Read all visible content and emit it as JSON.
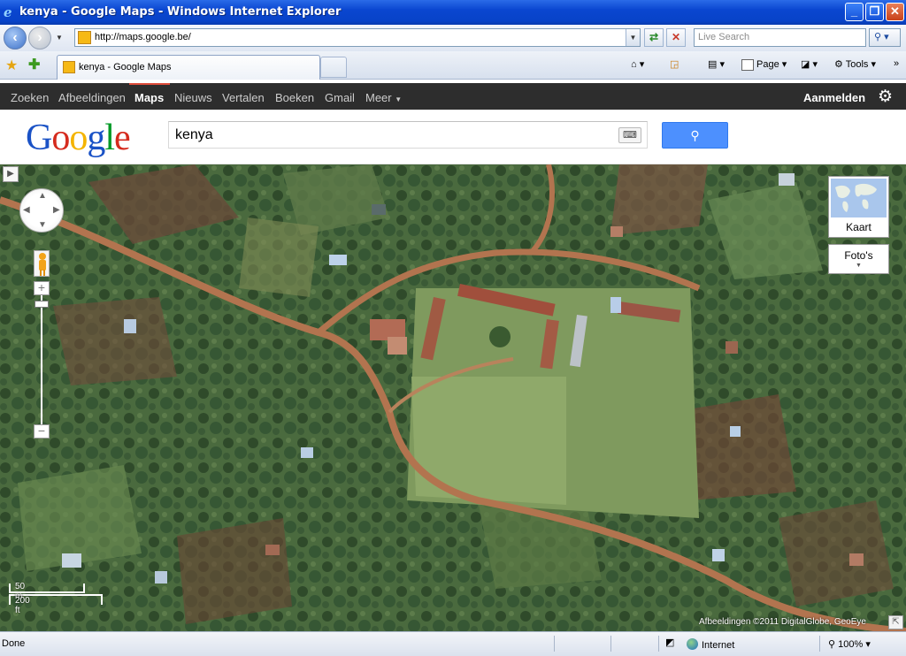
{
  "window": {
    "title": "kenya - Google Maps - Windows Internet Explorer",
    "controls": {
      "minimize": "_",
      "maximize": "❐",
      "close": "✕"
    }
  },
  "browser": {
    "address": "http://maps.google.be/",
    "search_placeholder": "Live Search",
    "tab_title": "kenya - Google Maps",
    "commands": {
      "page": "Page",
      "tools": "Tools"
    }
  },
  "gbar": {
    "items": [
      "Zoeken",
      "Afbeeldingen",
      "Maps",
      "Nieuws",
      "Vertalen",
      "Boeken",
      "Gmail",
      "Meer"
    ],
    "active_index": 2,
    "signin": "Aanmelden"
  },
  "search": {
    "logo": "Google",
    "query": "kenya"
  },
  "map": {
    "map_types": {
      "kaart": "Kaart",
      "fotos": "Foto's"
    },
    "scale": {
      "metric": "50 m",
      "imperial": "200 ft"
    },
    "attribution": "Afbeeldingen ©2011 DigitalGlobe, GeoEye"
  },
  "statusbar": {
    "status": "Done",
    "zone": "Internet",
    "zoom": "100%"
  },
  "colors": {
    "titlebar": "#0843c8",
    "gbar": "#2d2d2d",
    "search_button": "#4d90fe",
    "active_accent": "#dd4b39"
  }
}
